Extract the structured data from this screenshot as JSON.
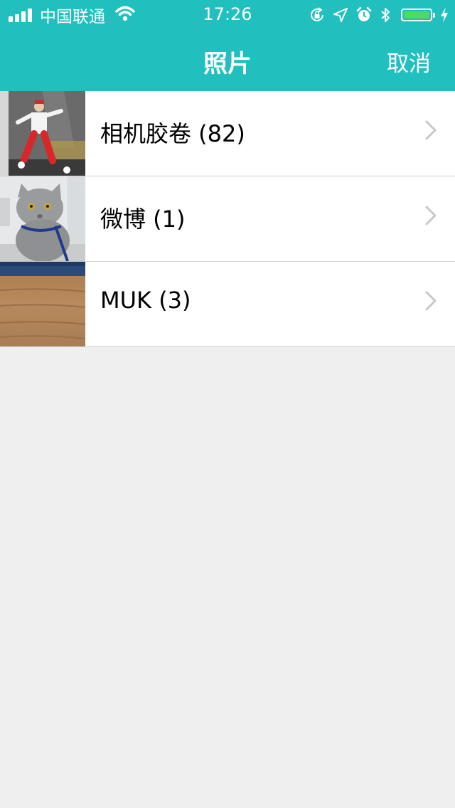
{
  "status_bar": {
    "carrier": "中国联通",
    "time": "17:26",
    "signal_icon": "signal-bars-icon",
    "wifi_icon": "wifi-icon",
    "orientation_lock_icon": "orientation-lock-icon",
    "location_icon": "location-arrow-icon",
    "alarm_icon": "alarm-clock-icon",
    "bluetooth_icon": "bluetooth-icon",
    "battery_icon": "battery-icon",
    "battery_level": 1.0,
    "charging_icon": "charging-bolt-icon"
  },
  "nav": {
    "title": "照片",
    "cancel_label": "取消"
  },
  "albums": [
    {
      "label": "相机胶卷 (82)",
      "thumbnail": "dancer-on-stage",
      "chevron_icon": "chevron-right-icon"
    },
    {
      "label": "微博 (1)",
      "thumbnail": "grey-cat",
      "chevron_icon": "chevron-right-icon"
    },
    {
      "label": "MUK (3)",
      "thumbnail": "wooden-surface",
      "chevron_icon": "chevron-right-icon"
    }
  ],
  "colors": {
    "header_bg": "#21c0bf",
    "page_bg": "#efeff0",
    "battery_fill": "#4cd964",
    "chevron": "#c7c7cc"
  }
}
